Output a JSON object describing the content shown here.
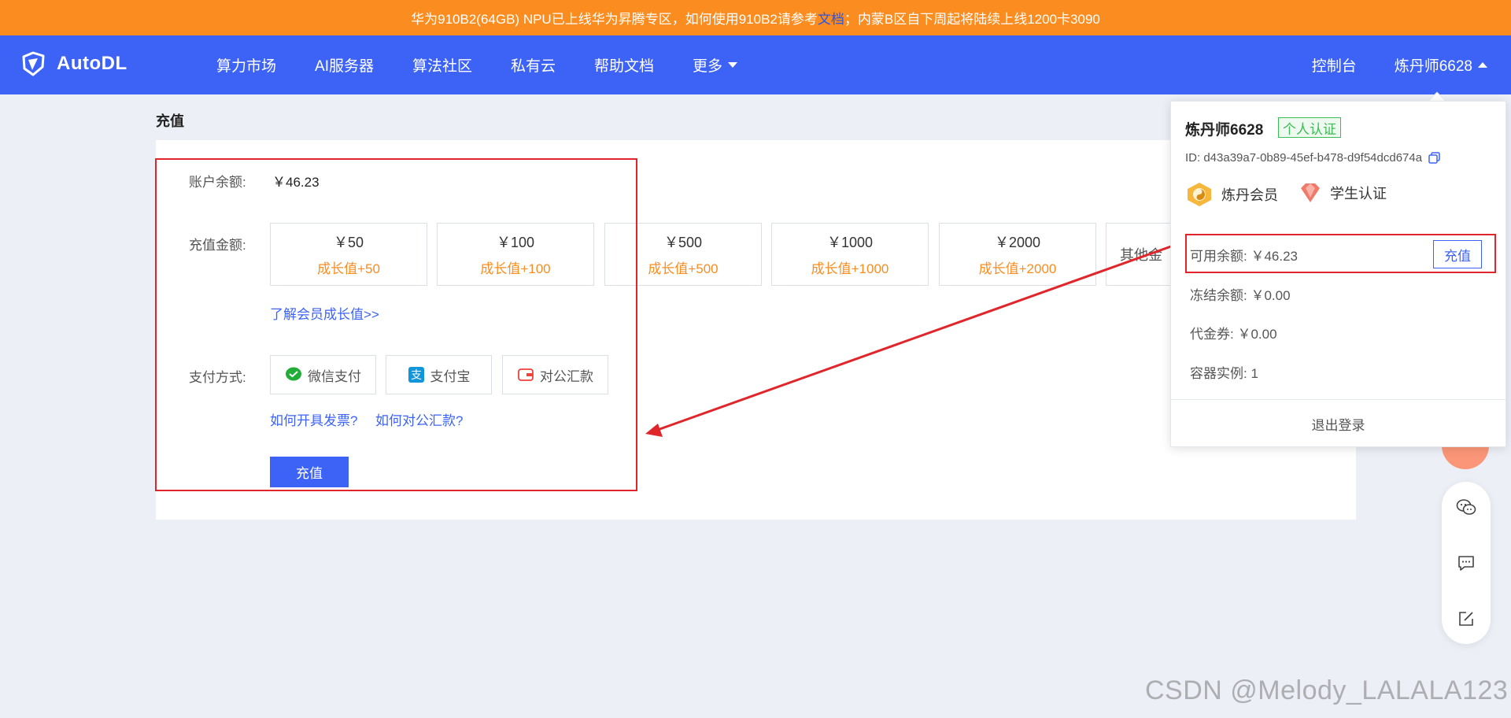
{
  "banner": {
    "text_before": "华为910B2(64GB) NPU已上线华为昇腾专区，如何使用910B2请参考",
    "doc_link": "文档",
    "text_after": "；内蒙B区自下周起将陆续上线1200卡3090"
  },
  "navbar": {
    "logo": "AutoDL",
    "items": [
      "算力市场",
      "AI服务器",
      "算法社区",
      "私有云",
      "帮助文档"
    ],
    "more": "更多",
    "console": "控制台",
    "user": "炼丹师6628"
  },
  "page": {
    "title": "充值",
    "balance_label": "账户余额:",
    "balance_value": "￥46.23",
    "amount_label": "充值金额:",
    "amounts": [
      {
        "amount": "￥50",
        "growth": "成长值+50"
      },
      {
        "amount": "￥100",
        "growth": "成长值+100"
      },
      {
        "amount": "￥500",
        "growth": "成长值+500"
      },
      {
        "amount": "￥1000",
        "growth": "成长值+1000"
      },
      {
        "amount": "￥2000",
        "growth": "成长值+2000"
      }
    ],
    "other_amount": "其他金",
    "growth_link": "了解会员成长值>>",
    "payment_label": "支付方式:",
    "payments": [
      "微信支付",
      "支付宝",
      "对公汇款"
    ],
    "invoice_link": "如何开具发票?",
    "transfer_link": "如何对公汇款?",
    "submit": "充值"
  },
  "dropdown": {
    "username": "炼丹师6628",
    "cert": "个人认证",
    "id": "ID: d43a39a7-0b89-45ef-b478-d9f54dcd674a",
    "member": "炼丹会员",
    "student": "学生认证",
    "available": "可用余额:  ￥46.23",
    "charge": "充值",
    "frozen": "冻结余额:  ￥0.00",
    "voucher": "代金券:  ￥0.00",
    "instances": "容器实例:  1",
    "logout": "退出登录"
  },
  "watermark": "CSDN @Melody_LALALA123",
  "colors": {
    "banner": "#fb8c1f",
    "navbar": "#3d63f6",
    "accent": "#3d63f6",
    "growth": "#fb8c1f",
    "highlight": "#e0262b",
    "cert_green": "#3dbb55"
  },
  "icons": [
    "autodl-logo-icon",
    "wechat-pay-icon",
    "alipay-icon",
    "bank-transfer-icon",
    "copy-icon",
    "member-medal-icon",
    "student-diamond-icon",
    "wechat-icon",
    "feedback-icon",
    "edit-icon"
  ]
}
